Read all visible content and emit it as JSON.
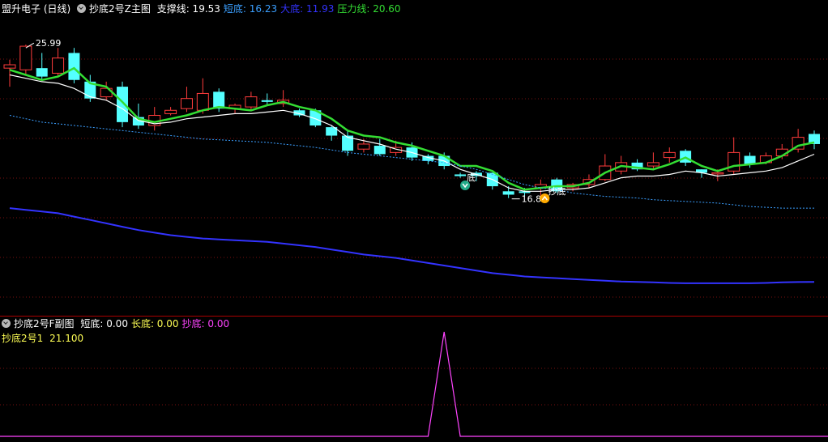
{
  "main_panel": {
    "stock_name": "盟升电子 (日线)",
    "indicator_name": "抄底2号Z主图",
    "values": [
      {
        "label": "支撑线:",
        "value": "19.53",
        "color": "#ffffff"
      },
      {
        "label": "短底:",
        "value": "16.23",
        "color": "#3b9fff"
      },
      {
        "label": "大底:",
        "value": "11.93",
        "color": "#3333ff"
      },
      {
        "label": "压力线:",
        "value": "20.60",
        "color": "#33dd33"
      }
    ],
    "annotations": {
      "high_label": "25.99",
      "low_label": "16.8",
      "buy_label_1": "底",
      "buy_label_2": "抄底"
    }
  },
  "sub_panel": {
    "indicator_name": "抄底2号F副图",
    "values": [
      {
        "label": "短底:",
        "value": "0.00",
        "color": "#ffffff"
      },
      {
        "label": "长底:",
        "value": "0.00",
        "color": "#ffff55"
      },
      {
        "label": "抄底:",
        "value": "0.00",
        "color": "#ff44ff"
      }
    ],
    "line2_label": "抄底2号1",
    "line2_value": "21.100",
    "line2_color": "#ffff55"
  },
  "chart_data": [
    {
      "type": "candlestick",
      "title": "抄底2号Z主图",
      "ylim": [
        10.5,
        27.2
      ],
      "candles": [
        [
          24.6,
          24.8,
          23.5,
          25.1
        ],
        [
          24.5,
          25.9,
          24.2,
          25.99
        ],
        [
          24.6,
          24.1,
          23.9,
          25.5
        ],
        [
          24.3,
          25.2,
          24.1,
          25.8
        ],
        [
          25.5,
          23.9,
          23.7,
          25.8
        ],
        [
          23.8,
          22.8,
          22.6,
          24.2
        ],
        [
          22.9,
          23.4,
          22.7,
          23.8
        ],
        [
          23.5,
          21.4,
          21.1,
          23.8
        ],
        [
          21.7,
          21.2,
          21.0,
          22.5
        ],
        [
          21.2,
          21.8,
          20.9,
          22.3
        ],
        [
          21.9,
          22.1,
          21.8,
          22.3
        ],
        [
          22.2,
          22.8,
          22.0,
          23.5
        ],
        [
          22.1,
          23.1,
          21.9,
          24.0
        ],
        [
          23.2,
          22.2,
          22.0,
          23.4
        ],
        [
          22.2,
          22.4,
          21.9,
          22.5
        ],
        [
          22.3,
          22.9,
          22.1,
          23.2
        ],
        [
          22.7,
          22.6,
          22.4,
          23.1
        ],
        [
          22.5,
          22.7,
          22.3,
          23.3
        ],
        [
          22.1,
          21.8,
          21.7,
          22.2
        ],
        [
          22.1,
          21.2,
          21.1,
          22.2
        ],
        [
          21.1,
          20.6,
          20.3,
          21.2
        ],
        [
          20.6,
          19.7,
          19.4,
          20.9
        ],
        [
          19.8,
          20.1,
          19.6,
          20.4
        ],
        [
          20.0,
          19.5,
          19.4,
          20.4
        ],
        [
          19.6,
          19.9,
          19.4,
          20.3
        ],
        [
          19.9,
          19.3,
          19.1,
          20.2
        ],
        [
          19.4,
          19.1,
          18.9,
          19.5
        ],
        [
          19.4,
          18.8,
          18.6,
          19.6
        ],
        [
          18.3,
          18.2,
          18.1,
          18.4
        ],
        [
          18.4,
          18.2,
          17.9,
          18.5
        ],
        [
          18.4,
          17.6,
          17.4,
          18.4
        ],
        [
          17.3,
          17.1,
          16.9,
          17.6
        ],
        [
          17.3,
          17.2,
          17.0,
          17.5
        ],
        [
          17.5,
          17.7,
          16.8,
          18.0
        ],
        [
          18.0,
          17.3,
          17.2,
          18.1
        ],
        [
          17.5,
          17.7,
          17.3,
          17.8
        ],
        [
          17.7,
          18.0,
          17.5,
          18.3
        ],
        [
          18.0,
          18.8,
          17.9,
          19.5
        ],
        [
          18.5,
          19.0,
          18.3,
          19.4
        ],
        [
          19.0,
          18.6,
          18.5,
          19.2
        ],
        [
          18.8,
          19.0,
          18.6,
          19.6
        ],
        [
          19.3,
          19.6,
          19.0,
          19.9
        ],
        [
          19.7,
          19.0,
          18.8,
          19.8
        ],
        [
          18.6,
          18.4,
          18.1,
          18.6
        ],
        [
          18.4,
          18.4,
          17.9,
          18.6
        ],
        [
          18.5,
          19.6,
          18.3,
          20.5
        ],
        [
          19.4,
          18.9,
          18.7,
          19.6
        ],
        [
          19.0,
          19.4,
          18.9,
          19.6
        ],
        [
          19.4,
          19.8,
          19.2,
          20.1
        ],
        [
          19.8,
          20.5,
          19.6,
          21.0
        ],
        [
          20.7,
          20.1,
          19.8,
          20.9
        ]
      ],
      "series": [
        {
          "name": "压力线",
          "color": "#33dd33",
          "values": [
            24.5,
            24.2,
            23.9,
            24.1,
            24.6,
            23.7,
            23.5,
            22.6,
            21.6,
            21.4,
            21.6,
            21.8,
            22.1,
            22.3,
            22.2,
            22.1,
            22.4,
            22.6,
            22.3,
            22.1,
            21.6,
            20.9,
            20.6,
            20.5,
            20.2,
            20.0,
            19.7,
            19.4,
            18.8,
            18.8,
            18.5,
            17.8,
            17.4,
            17.5,
            17.6,
            17.6,
            17.8,
            18.4,
            18.8,
            18.7,
            18.6,
            18.9,
            19.3,
            18.8,
            18.5,
            18.8,
            18.9,
            19.0,
            19.4,
            20.0,
            20.2
          ]
        },
        {
          "name": "支撑线",
          "color": "#ffffff",
          "values": [
            24.2,
            24.0,
            23.8,
            23.7,
            23.4,
            22.9,
            22.7,
            22.2,
            21.5,
            21.3,
            21.4,
            21.6,
            21.7,
            21.8,
            21.9,
            21.9,
            22.0,
            22.1,
            21.9,
            21.6,
            21.2,
            20.5,
            20.3,
            20.1,
            19.8,
            19.6,
            19.3,
            19.1,
            18.6,
            18.3,
            18.0,
            17.5,
            17.3,
            17.3,
            17.4,
            17.4,
            17.5,
            17.8,
            18.1,
            18.2,
            18.2,
            18.3,
            18.5,
            18.4,
            18.2,
            18.3,
            18.4,
            18.5,
            18.7,
            19.1,
            19.5
          ]
        },
        {
          "name": "短底",
          "color": "#3b9fff",
          "values": [
            21.8,
            21.6,
            21.4,
            21.3,
            21.2,
            21.1,
            21.0,
            20.9,
            20.8,
            20.7,
            20.6,
            20.5,
            20.4,
            20.35,
            20.3,
            20.25,
            20.2,
            20.1,
            20.0,
            19.9,
            19.75,
            19.6,
            19.5,
            19.4,
            19.3,
            19.2,
            19.1,
            19.0,
            18.8,
            18.6,
            18.3,
            18.0,
            17.7,
            17.5,
            17.4,
            17.2,
            17.1,
            17.0,
            16.95,
            16.9,
            16.8,
            16.75,
            16.7,
            16.65,
            16.6,
            16.5,
            16.4,
            16.35,
            16.3,
            16.3,
            16.3
          ]
        },
        {
          "name": "大底",
          "color": "#3333ff",
          "values": [
            16.3,
            16.2,
            16.1,
            16.0,
            15.8,
            15.6,
            15.4,
            15.2,
            15.0,
            14.85,
            14.7,
            14.6,
            14.5,
            14.45,
            14.4,
            14.35,
            14.3,
            14.2,
            14.1,
            14.0,
            13.85,
            13.7,
            13.55,
            13.45,
            13.35,
            13.2,
            13.05,
            12.9,
            12.75,
            12.6,
            12.45,
            12.35,
            12.25,
            12.2,
            12.15,
            12.1,
            12.05,
            12.0,
            11.95,
            11.93,
            11.9,
            11.87,
            11.85,
            11.85,
            11.85,
            11.85,
            11.85,
            11.87,
            11.9,
            11.92,
            11.93
          ]
        }
      ]
    },
    {
      "type": "line",
      "title": "抄底2号F副图",
      "series": [
        {
          "name": "抄底",
          "color": "#ff44ff",
          "values": [
            0,
            0,
            0,
            0,
            0,
            0,
            0,
            0,
            0,
            0,
            0,
            0,
            0,
            0,
            0,
            0,
            0,
            0,
            0,
            0,
            0,
            0,
            0,
            0,
            0,
            0,
            0,
            21.1,
            0,
            0,
            0,
            0,
            0,
            0,
            0,
            0,
            0,
            0,
            0,
            0,
            0,
            0,
            0,
            0,
            0,
            0,
            0,
            0,
            0,
            0,
            0
          ]
        }
      ]
    }
  ]
}
